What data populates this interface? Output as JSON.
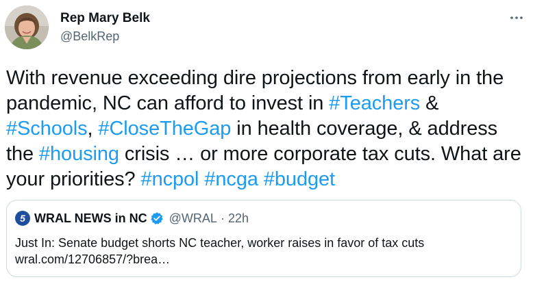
{
  "author": {
    "display_name": "Rep Mary Belk",
    "handle": "@BelkRep",
    "avatar_icon": "profile-photo"
  },
  "more_icon": "ellipsis-icon",
  "tweet": {
    "segments": [
      {
        "text": "With revenue exceeding dire projections from early in the pandemic, NC can afford to invest in ",
        "type": "text"
      },
      {
        "text": "#Teachers",
        "type": "hashtag"
      },
      {
        "text": " & ",
        "type": "text"
      },
      {
        "text": "#Schools",
        "type": "hashtag"
      },
      {
        "text": ", ",
        "type": "text"
      },
      {
        "text": "#CloseTheGap",
        "type": "hashtag"
      },
      {
        "text": " in health coverage, & address the ",
        "type": "text"
      },
      {
        "text": "#housing",
        "type": "hashtag"
      },
      {
        "text": " crisis … or more corporate tax cuts. What are your priorities? ",
        "type": "text"
      },
      {
        "text": "#ncpol",
        "type": "hashtag"
      },
      {
        "text": " ",
        "type": "text"
      },
      {
        "text": "#ncga",
        "type": "hashtag"
      },
      {
        "text": " ",
        "type": "text"
      },
      {
        "text": "#budget",
        "type": "hashtag"
      }
    ]
  },
  "quote": {
    "logo_text": "5",
    "display_name": "WRAL NEWS in NC",
    "verified": true,
    "handle": "@WRAL",
    "separator": "·",
    "time": "22h",
    "body": "Just In: Senate budget shorts NC teacher, worker raises in favor of tax cuts wral.com/12706857/?brea…"
  },
  "colors": {
    "text": "#0f1419",
    "secondary": "#536471",
    "link": "#1d9bf0",
    "border": "#cfd9de",
    "verified": "#1d9bf0",
    "wral_blue": "#1f4e9c"
  }
}
